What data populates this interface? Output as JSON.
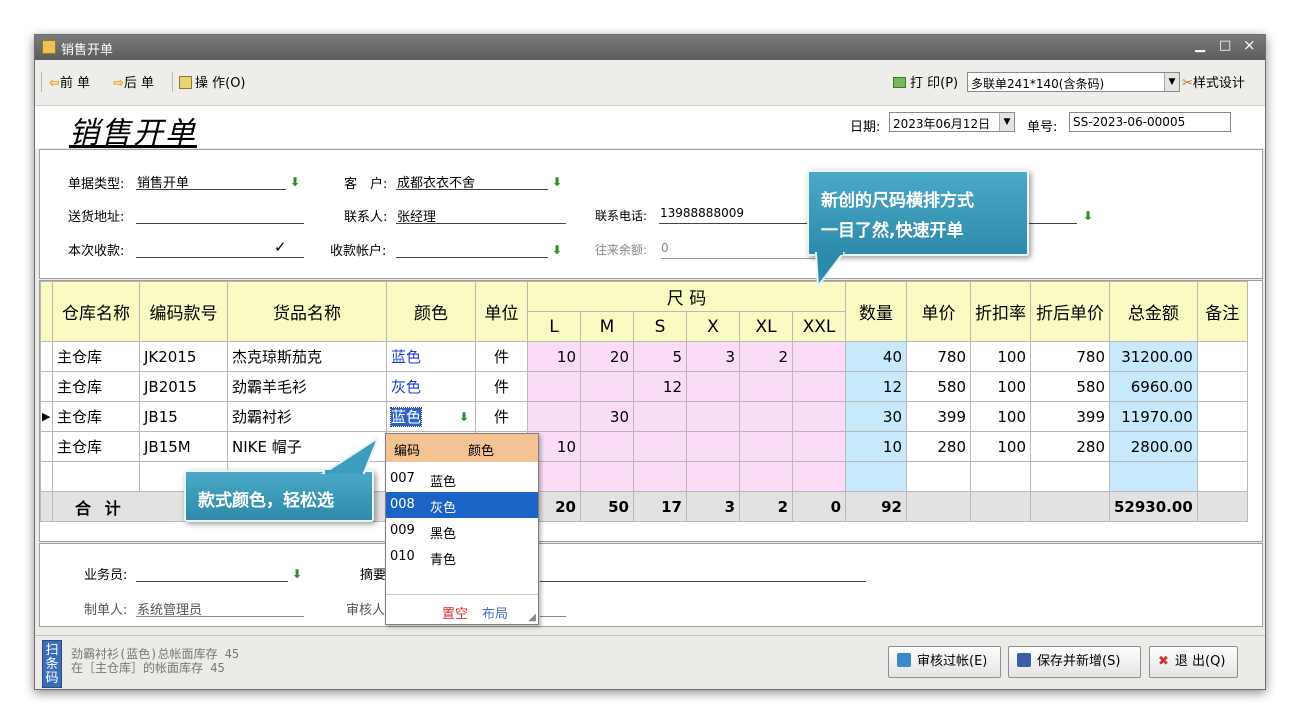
{
  "window": {
    "title": "销售开单",
    "btn_min": "▁",
    "btn_max": "□",
    "btn_close": "×"
  },
  "toolbar": {
    "prev": "前 单",
    "next": "后 单",
    "ops": "操 作(O)",
    "print": "打 印(P)",
    "print_template": "多联单241*140(含条码)",
    "style_design": "样式设计"
  },
  "header": {
    "title": "销售开单",
    "date_label": "日期:",
    "date_value": "2023年06月12日",
    "no_label": "单号:",
    "no_value": "SS-2023-06-00005"
  },
  "form": {
    "doc_type_label": "单据类型:",
    "doc_type": "销售开单",
    "customer_label": "客　户:",
    "customer": "成都衣衣不舍",
    "address_label": "送货地址:",
    "address": "",
    "contact_label": "联系人:",
    "contact": "张经理",
    "phone_label": "联系电话:",
    "phone": "13988888009",
    "receipt_label": "本次收款:",
    "receipt": "",
    "account_label": "收款帐户:",
    "account": "",
    "balance_label": "往来余额:",
    "balance": "0"
  },
  "grid": {
    "headers": {
      "warehouse": "仓库名称",
      "code": "编码款号",
      "name": "货品名称",
      "color": "颜色",
      "unit": "单位",
      "size_group": "尺 码",
      "qty": "数量",
      "price": "单价",
      "discount": "折扣率",
      "disc_price": "折后单价",
      "amount": "总金额",
      "remark": "备注"
    },
    "sizes": [
      "L",
      "M",
      "S",
      "X",
      "XL",
      "XXL"
    ],
    "rows": [
      {
        "warehouse": "主仓库",
        "code": "JK2015",
        "name": "杰克琼斯茄克",
        "color": "蓝色",
        "unit": "件",
        "sizes": [
          "10",
          "20",
          "5",
          "3",
          "2",
          ""
        ],
        "qty": "40",
        "price": "780",
        "discount": "100",
        "disc_price": "780",
        "amount": "31200.00"
      },
      {
        "warehouse": "主仓库",
        "code": "JB2015",
        "name": "劲霸羊毛衫",
        "color": "灰色",
        "unit": "件",
        "sizes": [
          "",
          "",
          "12",
          "",
          "",
          ""
        ],
        "qty": "12",
        "price": "580",
        "discount": "100",
        "disc_price": "580",
        "amount": "6960.00"
      },
      {
        "warehouse": "主仓库",
        "code": "JB15",
        "name": "劲霸衬衫",
        "color": "蓝色",
        "unit": "件",
        "sizes": [
          "",
          "30",
          "",
          "",
          "",
          ""
        ],
        "qty": "30",
        "price": "399",
        "discount": "100",
        "disc_price": "399",
        "amount": "11970.00"
      },
      {
        "warehouse": "主仓库",
        "code": "JB15M",
        "name": "NIKE 帽子",
        "color": "",
        "unit": "",
        "sizes": [
          "10",
          "",
          "",
          "",
          "",
          ""
        ],
        "qty": "10",
        "price": "280",
        "discount": "100",
        "disc_price": "280",
        "amount": "2800.00"
      }
    ],
    "total": {
      "label": "合 计",
      "sizes": [
        "20",
        "50",
        "17",
        "3",
        "2",
        "0"
      ],
      "qty": "92",
      "amount": "52930.00"
    }
  },
  "color_dropdown": {
    "col_code": "编码",
    "col_color": "颜色",
    "options": [
      {
        "code": "007",
        "color": "蓝色"
      },
      {
        "code": "008",
        "color": "灰色"
      },
      {
        "code": "009",
        "color": "黑色"
      },
      {
        "code": "010",
        "color": "青色"
      }
    ],
    "selected_index": 1,
    "clear": "置空",
    "layout": "布局"
  },
  "bottom": {
    "salesman_label": "业务员:",
    "salesman": "",
    "summary_label": "摘要",
    "creator_label": "制单人:",
    "creator": "系统管理员",
    "auditor_label": "审核人"
  },
  "status": {
    "scan": "扫条码",
    "line1": "劲霸衬衫(蓝色)总帐面库存 45",
    "line2": "在［主仓库］的帐面库存 45"
  },
  "actions": {
    "audit": "审核过帐(E)",
    "save_new": "保存并新增(S)",
    "exit": "退 出(Q)"
  },
  "callouts": {
    "size_line1": "新创的尺码横排方式",
    "size_line2": "一目了然,快速开单",
    "color": "款式颜色，轻松选"
  },
  "colors": {
    "pink": "#fbdcf6",
    "blue": "#c8e8fb",
    "yellow": "#fafac3",
    "callout": "#3a9aba"
  }
}
